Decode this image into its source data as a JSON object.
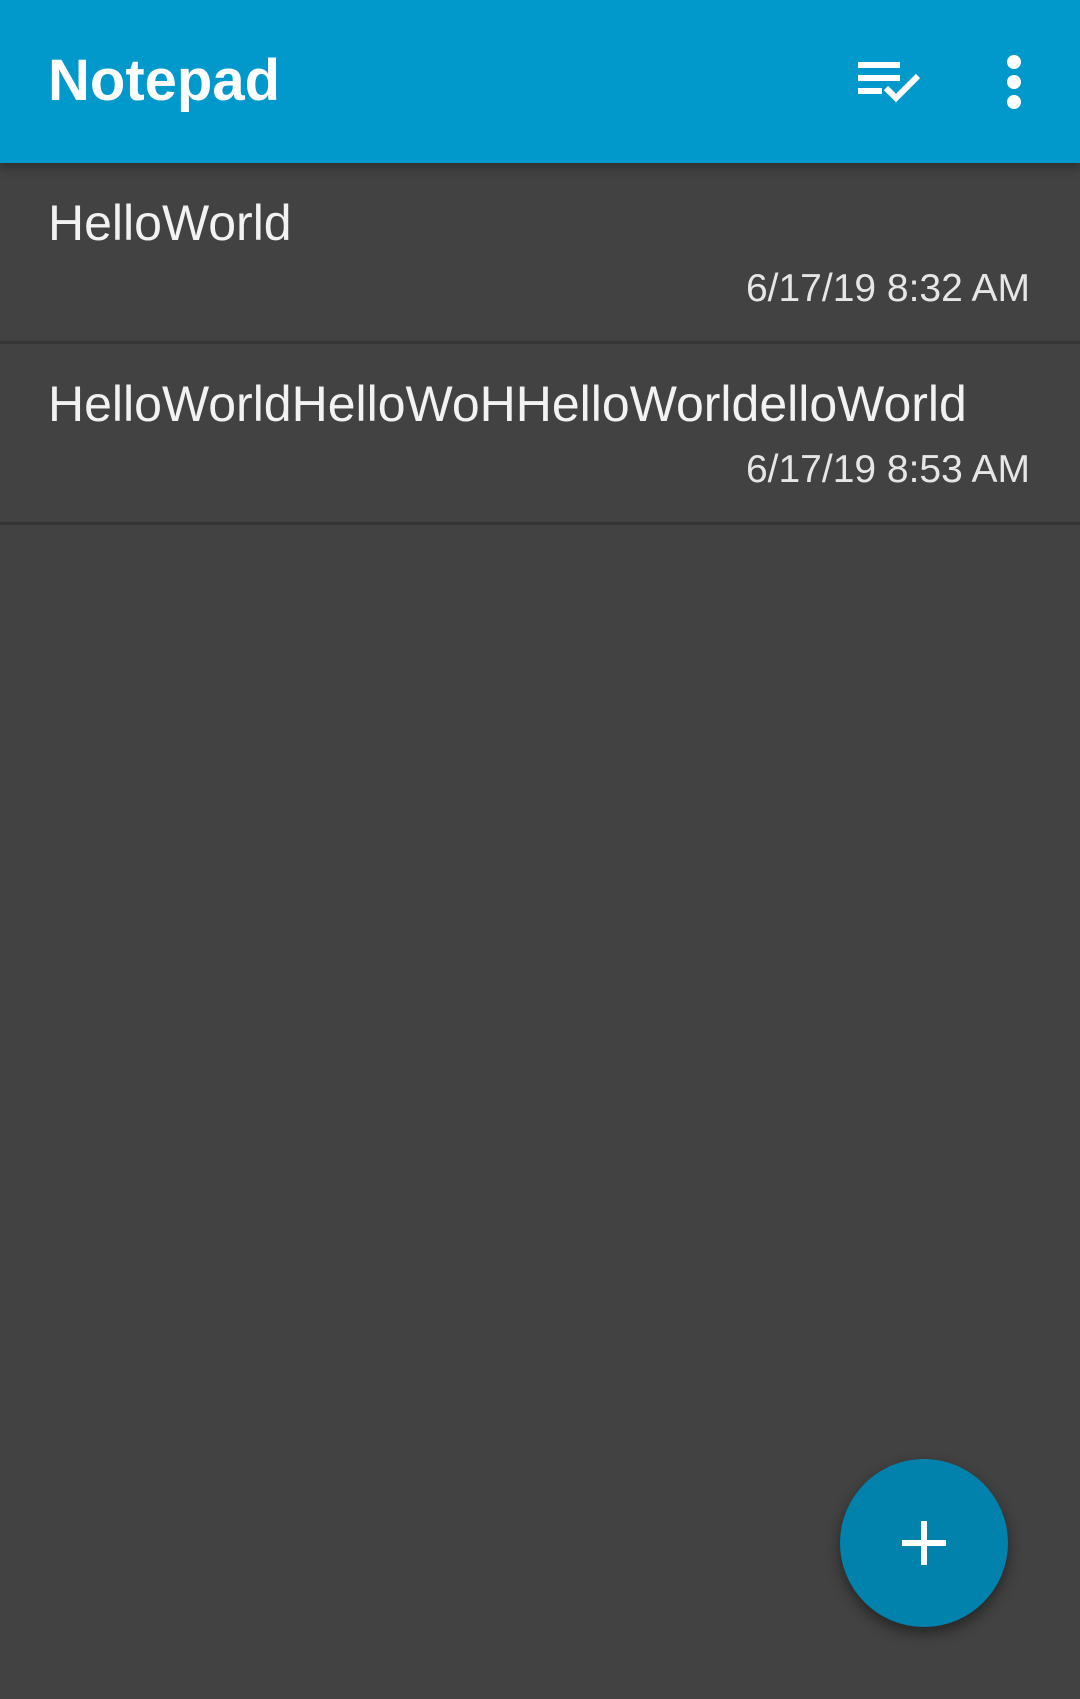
{
  "toolbar": {
    "title": "Notepad",
    "background_color": "#0199cb",
    "actions": [
      {
        "icon": "checklist-icon"
      },
      {
        "icon": "more-vert-icon"
      }
    ]
  },
  "notes": [
    {
      "title": "HelloWorld",
      "date": "6/17/19 8:32 AM"
    },
    {
      "title": "HelloWorldHelloWoHHelloWorldelloWorld",
      "date": "6/17/19 8:53 AM"
    }
  ],
  "fab": {
    "icon": "plus-icon",
    "color": "#0182ad"
  },
  "colors": {
    "background": "#424242",
    "text_primary": "#f2f2f2"
  }
}
